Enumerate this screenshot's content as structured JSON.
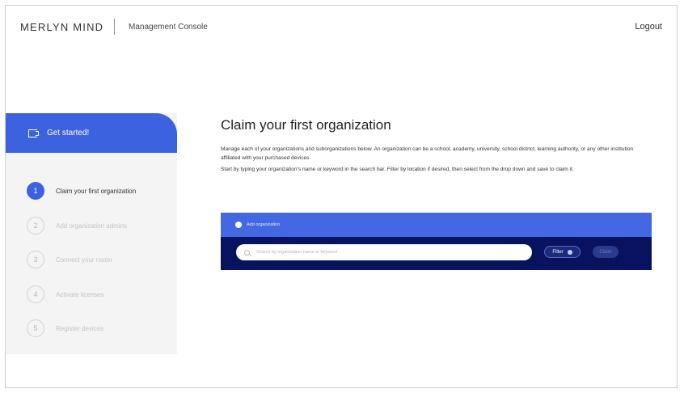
{
  "header": {
    "brand": "MERLYN MIND",
    "subtitle": "Management Console",
    "logout_label": "Logout"
  },
  "sidebar": {
    "get_started_label": "Get started!",
    "steps": [
      {
        "number": "1",
        "label": "Claim your first organization",
        "active": true
      },
      {
        "number": "2",
        "label": "Add organization admins",
        "active": false
      },
      {
        "number": "3",
        "label": "Connect your roster",
        "active": false
      },
      {
        "number": "4",
        "label": "Activate licenses",
        "active": false
      },
      {
        "number": "5",
        "label": "Register devices",
        "active": false
      }
    ]
  },
  "main": {
    "title": "Claim your first organization",
    "description_1": "Manage each of your organizations and suborganizations below. An organization can be a school, academy, university, school district, learning authority, or any other institution affiliated with your purchased devices.",
    "description_2": "Start by typing your organization's name or keyword in the search bar. Filter by location if desired, then select from the drop down and save to claim it.",
    "add_organization_label": "Add organization",
    "search_placeholder": "Search by organization name or keyword",
    "filter_label": "Filter",
    "claim_label": "Claim"
  },
  "colors": {
    "accent": "#3d62df",
    "panel_dark": "#08125e",
    "panel_top": "#4468e2"
  }
}
